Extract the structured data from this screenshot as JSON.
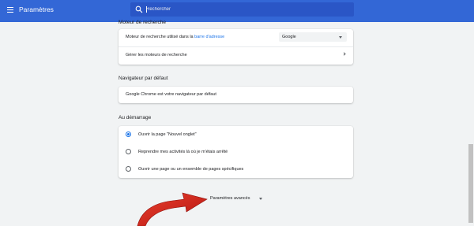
{
  "header": {
    "title": "Paramètres",
    "search_placeholder": "Rechercher"
  },
  "search_engine": {
    "section_title": "Moteur de recherche",
    "row1_prefix": "Moteur de recherche utilisé dans la ",
    "row1_link": "barre d'adresse",
    "selected_engine": "Google",
    "row2_label": "Gérer les moteurs de recherche"
  },
  "default_browser": {
    "section_title": "Navigateur par défaut",
    "status": "Google Chrome est votre navigateur par défaut"
  },
  "startup": {
    "section_title": "Au démarrage",
    "options": [
      {
        "label": "Ouvrir la page \"Nouvel onglet\"",
        "selected": true
      },
      {
        "label": "Reprendre mes activités là où je m'étais arrêté",
        "selected": false
      },
      {
        "label": "Ouvrir une page ou un ensemble de pages spécifiques",
        "selected": false
      }
    ]
  },
  "advanced": {
    "label": "Paramètres avancés"
  },
  "colors": {
    "header": "#3367d6",
    "accent": "#1a73e8",
    "annotation_arrow": "#d9261c"
  },
  "icons": {
    "menu": "hamburger-menu-icon",
    "search": "search-icon",
    "dropdown": "chevron-down-icon",
    "next": "chevron-right-icon"
  }
}
